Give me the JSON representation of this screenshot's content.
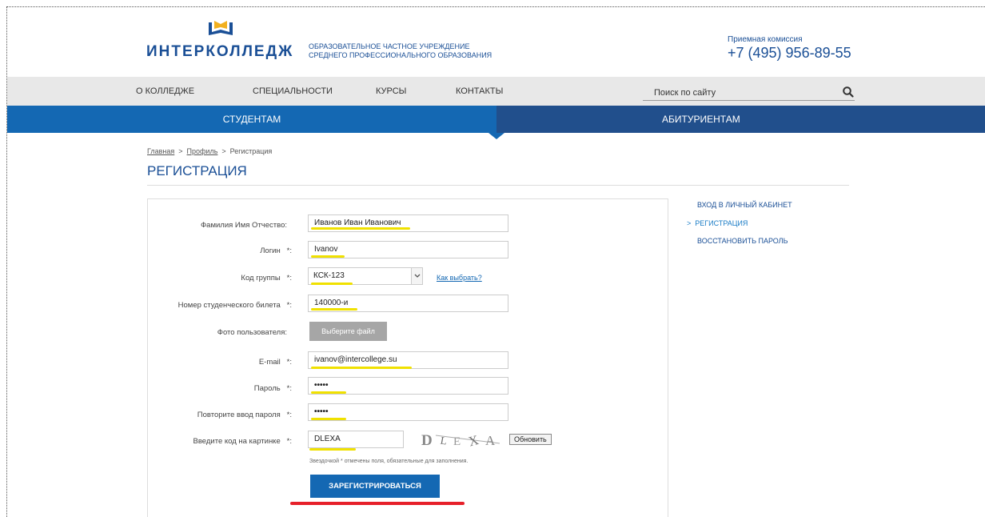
{
  "header": {
    "logo_text": "ИНТЕРКОЛЛЕДЖ",
    "org_line1": "ОБРАЗОВАТЕЛЬНОЕ ЧАСТНОЕ УЧРЕЖДЕНИЕ",
    "org_line2": "СРЕДНЕГО ПРОФЕССИОНАЛЬНОГО ОБРАЗОВАНИЯ",
    "admission_label": "Приемная комиссия",
    "admission_phone": "+7 (495) 956-89-55"
  },
  "nav": {
    "items": [
      "О КОЛЛЕДЖЕ",
      "СПЕЦИАЛЬНОСТИ",
      "КУРСЫ",
      "КОНТАКТЫ"
    ],
    "search_placeholder": "Поиск по сайту"
  },
  "audience": {
    "students": "СТУДЕНТАМ",
    "applicants": "АБИТУРИЕНТАМ"
  },
  "breadcrumb": {
    "home": "Главная",
    "profile": "Профиль",
    "current": "Регистрация",
    "separator": ">"
  },
  "page_title": "РЕГИСТРАЦИЯ",
  "form": {
    "fio_label": "Фамилия Имя Отчество:",
    "fio_value": "Иванов Иван Иванович",
    "login_label": "Логин",
    "login_value": "Ivanov",
    "group_label": "Код группы",
    "group_value": "КСК-123",
    "group_help": "Как выбрать?",
    "ticket_label": "Номер студенческого билета",
    "ticket_value": "140000-и",
    "photo_label": "Фото пользователя:",
    "photo_button": "Выберите файл",
    "email_label": "E-mail",
    "email_value": "ivanov@intercollege.su",
    "password_label": "Пароль",
    "password_value": "•••••",
    "password2_label": "Повторите ввод пароля",
    "password2_value": "•••••",
    "captcha_label": "Введите код на картинке",
    "captcha_value": "DLEXA",
    "captcha_image_text": "D L E X A",
    "refresh_button": "Обновить",
    "required_mark": "*:",
    "note": "Звездочкой * отмечены поля, обязательные для заполнения.",
    "submit": "ЗАРЕГИСТРИРОВАТЬСЯ"
  },
  "sidebar": {
    "login": "ВХОД В ЛИЧНЫЙ КАБИНЕТ",
    "register_marker": ">",
    "register": "РЕГИСТРАЦИЯ",
    "restore": "ВОССТАНОВИТЬ ПАРОЛЬ"
  },
  "colors": {
    "brand_blue": "#1a4f96",
    "students_bar": "#1468b3",
    "applicants_bar": "#214f8c",
    "highlight_yellow": "#f0e100",
    "highlight_red": "#e6202a"
  }
}
